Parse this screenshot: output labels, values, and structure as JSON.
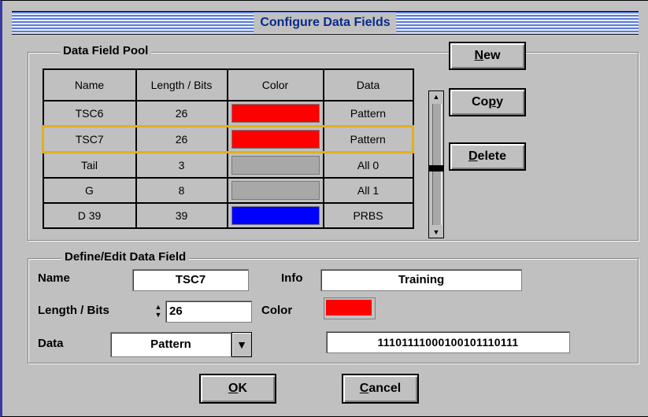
{
  "window": {
    "title": "Configure Data Fields"
  },
  "pool": {
    "label": "Data Field Pool",
    "columns": [
      "Name",
      "Length / Bits",
      "Color",
      "Data"
    ],
    "rows": [
      {
        "name": "TSC6",
        "length": "26",
        "color": "#ff0000",
        "data": "Pattern",
        "selected": false
      },
      {
        "name": "TSC7",
        "length": "26",
        "color": "#ff0000",
        "data": "Pattern",
        "selected": true
      },
      {
        "name": "Tail",
        "length": "3",
        "color": "#a8a8a8",
        "data": "All 0",
        "selected": false
      },
      {
        "name": "G",
        "length": "8",
        "color": "#a8a8a8",
        "data": "All 1",
        "selected": false
      },
      {
        "name": "D 39",
        "length": "39",
        "color": "#0000ff",
        "data": "PRBS",
        "selected": false
      }
    ],
    "buttons": {
      "new_u": "N",
      "new_rest": "ew",
      "copy_pre": "Co",
      "copy_u": "p",
      "copy_rest": "y",
      "delete_u": "D",
      "delete_rest": "elete"
    }
  },
  "edit": {
    "label": "Define/Edit Data Field",
    "name_label": "Name",
    "name_value": "TSC7",
    "info_label": "Info",
    "info_value": "Training",
    "length_label": "Length / Bits",
    "length_value": "26",
    "color_label": "Color",
    "color_value": "#ff0000",
    "data_label": "Data",
    "data_value": "Pattern",
    "pattern_value": "11101111000100101110111"
  },
  "footer": {
    "ok_u": "O",
    "ok_rest": "K",
    "cancel_u": "C",
    "cancel_rest": "ancel"
  }
}
